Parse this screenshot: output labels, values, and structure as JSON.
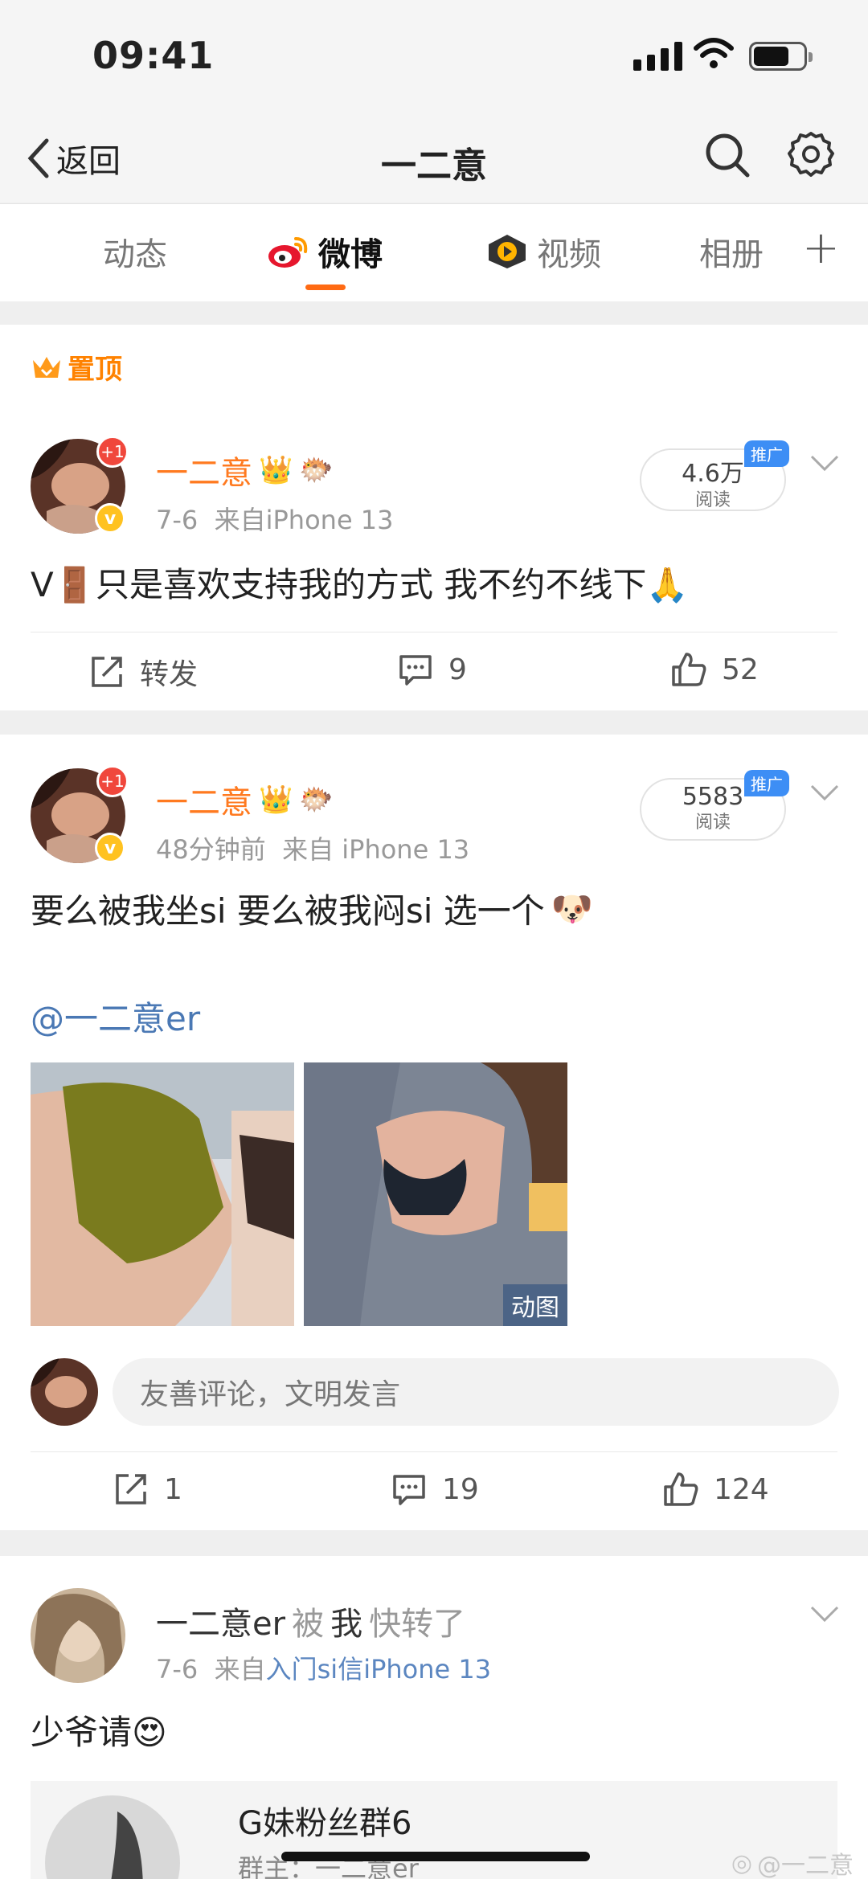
{
  "status_bar": {
    "time": "09:41"
  },
  "nav": {
    "back_label": "返回",
    "title": "一二意"
  },
  "tabs": [
    {
      "label": "动态",
      "active": false
    },
    {
      "label": "微博",
      "active": true
    },
    {
      "label": "视频",
      "active": false
    },
    {
      "label": "相册",
      "active": false
    }
  ],
  "pinned_label": "置顶",
  "posts": [
    {
      "username": "一二意",
      "avatar_badge": "+1",
      "meta_time": "7-6",
      "meta_source": "来自iPhone 13",
      "read_count": "4.6万",
      "read_label": "阅读",
      "promo_label": "推广",
      "text": "V🚪只是喜欢支持我的方式 我不约不线下🙏",
      "actions": {
        "repost": "转发",
        "comments": "9",
        "likes": "52"
      }
    },
    {
      "username": "一二意",
      "avatar_badge": "+1",
      "meta_time": "48分钟前",
      "meta_source": "来自 iPhone 13",
      "read_count": "5583",
      "read_label": "阅读",
      "promo_label": "推广",
      "text": "要么被我坐si 要么被我闷si 选一个",
      "mention": "@一二意er",
      "gif_label": "动图",
      "comment_placeholder": "友善评论，文明发言",
      "actions": {
        "repost": "1",
        "comments": "19",
        "likes": "124"
      }
    },
    {
      "username": "一二意er",
      "forwarded_by": "被",
      "forwarded_who": "我",
      "forwarded_suffix": "快转了",
      "meta_time": "7-6",
      "meta_source_prefix": "来自",
      "meta_source_link": "入门si信iPhone 13",
      "text": "少爷请😍",
      "group_title": "G妹粉丝群6",
      "group_owner": "群主：一二意er"
    }
  ],
  "watermark": "@一二意",
  "colors": {
    "accent": "#ff6a13",
    "username": "#ff7a20",
    "link": "#4a78b4",
    "promo": "#3d8ef5"
  }
}
